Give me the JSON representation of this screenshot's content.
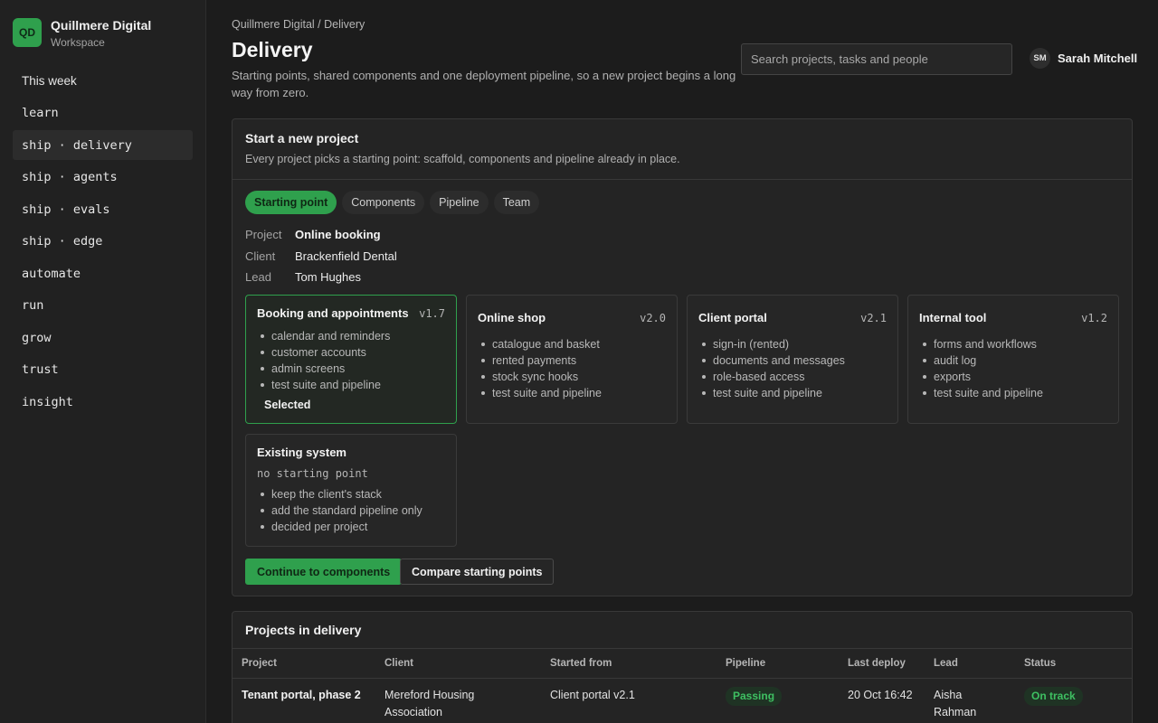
{
  "brand": {
    "initials": "QD",
    "name": "Quillmere Digital",
    "sub": "Workspace"
  },
  "nav": [
    {
      "label": "This week"
    },
    {
      "label": "learn"
    },
    {
      "label": "ship · delivery"
    },
    {
      "label": "ship · agents"
    },
    {
      "label": "ship · evals"
    },
    {
      "label": "ship · edge"
    },
    {
      "label": "automate"
    },
    {
      "label": "run"
    },
    {
      "label": "grow"
    },
    {
      "label": "trust"
    },
    {
      "label": "insight"
    }
  ],
  "header": {
    "breadcrumb": "Quillmere Digital / Delivery",
    "title": "Delivery",
    "subtitle": "Starting points, shared components and one deployment pipeline, so a new project begins a long way from zero.",
    "search_placeholder": "Search projects, tasks and people",
    "user_initials": "SM",
    "user_name": "Sarah Mitchell"
  },
  "new_project": {
    "title": "Start a new project",
    "description": "Every project picks a starting point: scaffold, components and pipeline already in place.",
    "tabs": [
      "Starting point",
      "Components",
      "Pipeline",
      "Team"
    ],
    "meta": [
      {
        "label": "Project",
        "value": "Online booking"
      },
      {
        "label": "Client",
        "value": "Brackenfield Dental"
      },
      {
        "label": "Lead",
        "value": "Tom Hughes"
      }
    ],
    "cards": [
      {
        "title": "Booking and appointments",
        "version": "v1.7",
        "items": [
          "calendar and reminders",
          "customer accounts",
          "admin screens",
          "test suite and pipeline"
        ],
        "selected_label": "Selected"
      },
      {
        "title": "Online shop",
        "version": "v2.0",
        "items": [
          "catalogue and basket",
          "rented payments",
          "stock sync hooks",
          "test suite and pipeline"
        ]
      },
      {
        "title": "Client portal",
        "version": "v2.1",
        "items": [
          "sign-in (rented)",
          "documents and messages",
          "role-based access",
          "test suite and pipeline"
        ]
      },
      {
        "title": "Internal tool",
        "version": "v1.2",
        "items": [
          "forms and workflows",
          "audit log",
          "exports",
          "test suite and pipeline"
        ]
      },
      {
        "title": "Existing system",
        "note": "no starting point",
        "items": [
          "keep the client's stack",
          "add the standard pipeline only",
          "decided per project"
        ]
      }
    ],
    "primary_button": "Continue to components",
    "secondary_button": "Compare starting points"
  },
  "projects": {
    "title": "Projects in delivery",
    "columns": [
      "Project",
      "Client",
      "Started from",
      "Pipeline",
      "Last deploy",
      "Lead",
      "Status"
    ],
    "rows": [
      {
        "project": "Tenant portal, phase 2",
        "client": "Mereford Housing Association",
        "started_from": "Client portal v2.1",
        "pipeline": "Passing",
        "last_deploy": "20 Oct 16:42",
        "lead": "Aisha Rahman",
        "status": "On track"
      }
    ]
  }
}
